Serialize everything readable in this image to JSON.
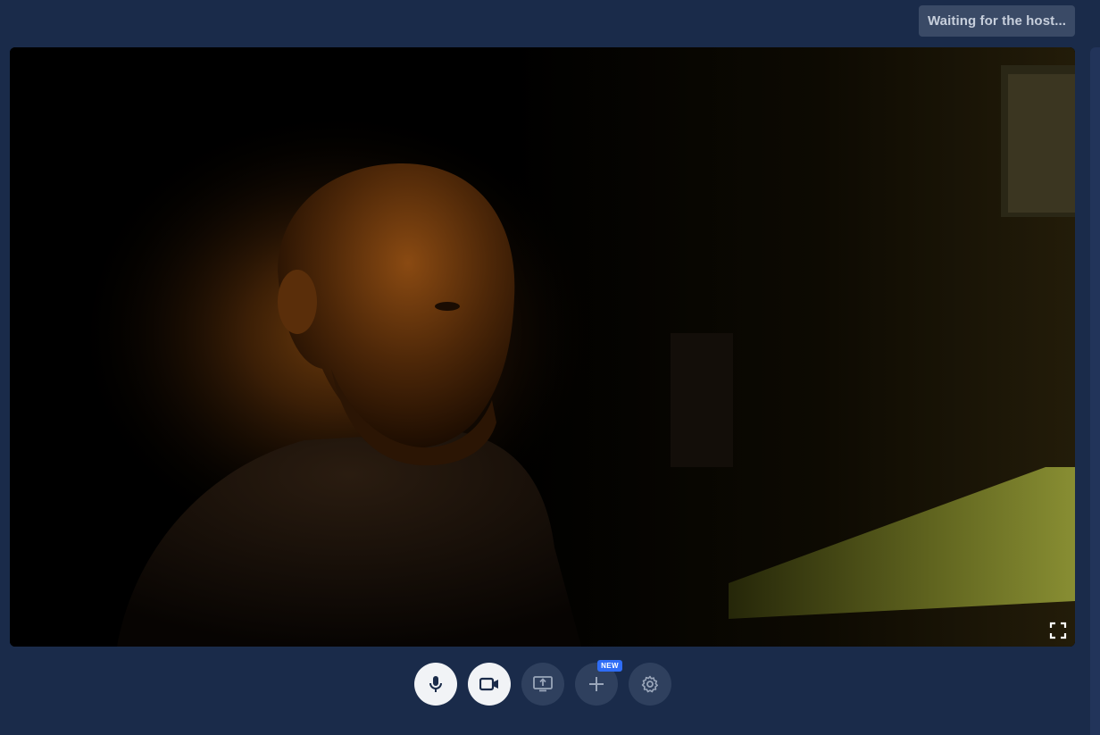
{
  "status": {
    "text": "Waiting for the host..."
  },
  "video": {
    "description_icon": "camera-feed"
  },
  "controls": {
    "microphone": {
      "icon": "microphone-icon",
      "state": "on"
    },
    "camera": {
      "icon": "video-camera-icon",
      "state": "on"
    },
    "share_screen": {
      "icon": "screen-share-icon",
      "state": "off"
    },
    "add": {
      "icon": "plus-icon",
      "badge": "NEW",
      "state": "off"
    },
    "settings": {
      "icon": "gear-icon",
      "state": "off"
    }
  },
  "colors": {
    "background": "#1a2b4a",
    "button_active": "#f1f3f6",
    "button_inactive": "#2f405e",
    "badge": "#2f6df6",
    "status_pill": "#3a4a66"
  }
}
